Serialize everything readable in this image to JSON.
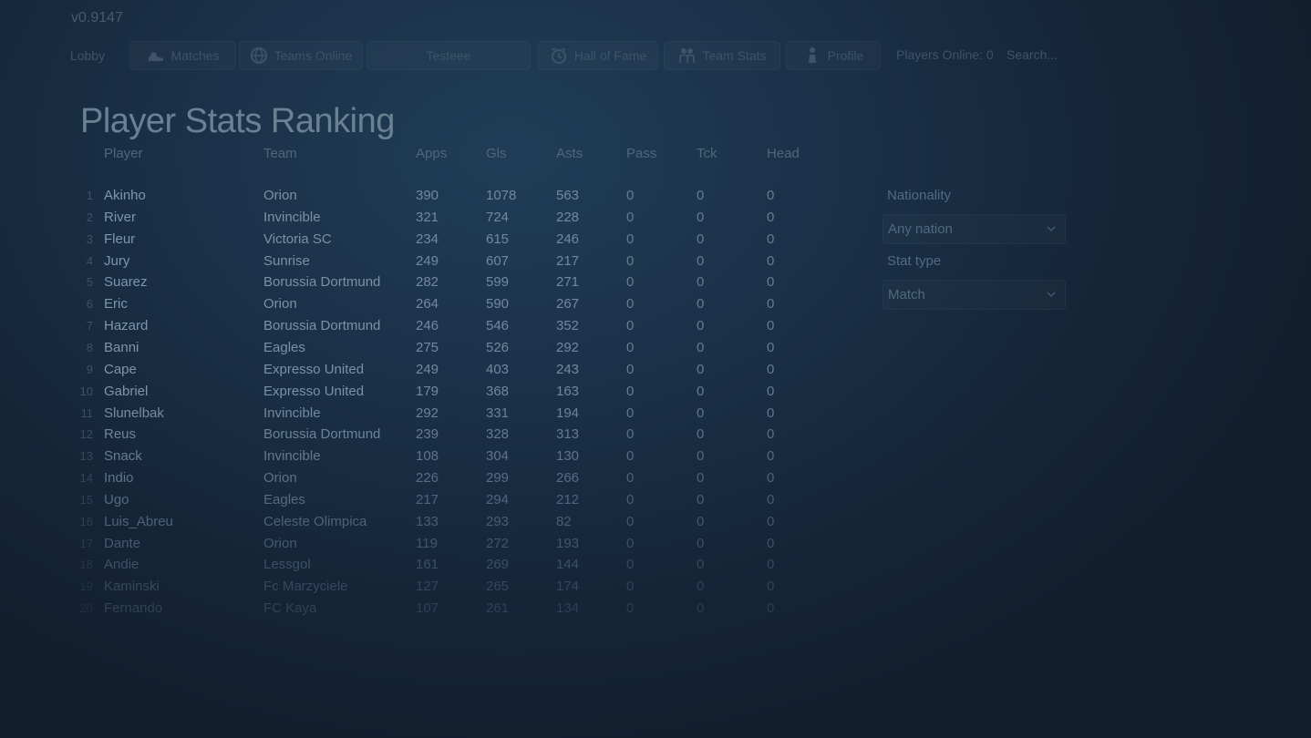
{
  "app": {
    "version": "v0.9147"
  },
  "nav": {
    "items": [
      {
        "label": "Lobby",
        "icon": "",
        "name": "nav-lobby-button",
        "plain": true
      },
      {
        "label": "Matches",
        "icon": "boot-icon",
        "name": "nav-matches-button"
      },
      {
        "label": "Teams Online",
        "icon": "globe-icon",
        "name": "nav-teams-online-button"
      },
      {
        "label": "Testeee",
        "icon": "",
        "name": "nav-testeee-button"
      },
      {
        "label": "Hall of Fame",
        "icon": "clock-icon",
        "name": "nav-hall-of-fame-button"
      },
      {
        "label": "Team Stats",
        "icon": "team-icon",
        "name": "nav-team-stats-button"
      },
      {
        "label": "Profile",
        "icon": "player-icon",
        "name": "nav-profile-button"
      }
    ],
    "players_online": "Players Online: 0",
    "search_placeholder": "Search..."
  },
  "page": {
    "title": "Player Stats Ranking"
  },
  "table": {
    "columns": [
      "Player",
      "Team",
      "Apps",
      "Gls",
      "Asts",
      "Pass",
      "Tck",
      "Head"
    ],
    "rows": [
      {
        "rank": "1",
        "player": "Akinho",
        "team": "Orion",
        "apps": "390",
        "gls": "1078",
        "asts": "563",
        "pass": "0",
        "tck": "0",
        "head": "0"
      },
      {
        "rank": "2",
        "player": "River",
        "team": "Invincible",
        "apps": "321",
        "gls": "724",
        "asts": "228",
        "pass": "0",
        "tck": "0",
        "head": "0"
      },
      {
        "rank": "3",
        "player": "Fleur",
        "team": "Victoria SC",
        "apps": "234",
        "gls": "615",
        "asts": "246",
        "pass": "0",
        "tck": "0",
        "head": "0"
      },
      {
        "rank": "4",
        "player": "Jury",
        "team": "Sunrise",
        "apps": "249",
        "gls": "607",
        "asts": "217",
        "pass": "0",
        "tck": "0",
        "head": "0"
      },
      {
        "rank": "5",
        "player": "Suarez",
        "team": "Borussia Dortmund",
        "apps": "282",
        "gls": "599",
        "asts": "271",
        "pass": "0",
        "tck": "0",
        "head": "0"
      },
      {
        "rank": "6",
        "player": "Eric",
        "team": "Orion",
        "apps": "264",
        "gls": "590",
        "asts": "267",
        "pass": "0",
        "tck": "0",
        "head": "0"
      },
      {
        "rank": "7",
        "player": "Hazard",
        "team": "Borussia Dortmund",
        "apps": "246",
        "gls": "546",
        "asts": "352",
        "pass": "0",
        "tck": "0",
        "head": "0"
      },
      {
        "rank": "8",
        "player": "Banni",
        "team": "Eagles",
        "apps": "275",
        "gls": "526",
        "asts": "292",
        "pass": "0",
        "tck": "0",
        "head": "0"
      },
      {
        "rank": "9",
        "player": "Cape",
        "team": "Expresso United",
        "apps": "249",
        "gls": "403",
        "asts": "243",
        "pass": "0",
        "tck": "0",
        "head": "0"
      },
      {
        "rank": "10",
        "player": "Gabriel",
        "team": "Expresso United",
        "apps": "179",
        "gls": "368",
        "asts": "163",
        "pass": "0",
        "tck": "0",
        "head": "0"
      },
      {
        "rank": "11",
        "player": "Slunelbak",
        "team": "Invincible",
        "apps": "292",
        "gls": "331",
        "asts": "194",
        "pass": "0",
        "tck": "0",
        "head": "0"
      },
      {
        "rank": "12",
        "player": "Reus",
        "team": "Borussia Dortmund",
        "apps": "239",
        "gls": "328",
        "asts": "313",
        "pass": "0",
        "tck": "0",
        "head": "0"
      },
      {
        "rank": "13",
        "player": "Snack",
        "team": "Invincible",
        "apps": "108",
        "gls": "304",
        "asts": "130",
        "pass": "0",
        "tck": "0",
        "head": "0"
      },
      {
        "rank": "14",
        "player": "Indio",
        "team": "Orion",
        "apps": "226",
        "gls": "299",
        "asts": "266",
        "pass": "0",
        "tck": "0",
        "head": "0"
      },
      {
        "rank": "15",
        "player": "Ugo",
        "team": "Eagles",
        "apps": "217",
        "gls": "294",
        "asts": "212",
        "pass": "0",
        "tck": "0",
        "head": "0"
      },
      {
        "rank": "16",
        "player": "Luis_Abreu",
        "team": "Celeste Olimpica",
        "apps": "133",
        "gls": "293",
        "asts": "82",
        "pass": "0",
        "tck": "0",
        "head": "0"
      },
      {
        "rank": "17",
        "player": "Dante",
        "team": "Orion",
        "apps": "119",
        "gls": "272",
        "asts": "193",
        "pass": "0",
        "tck": "0",
        "head": "0"
      },
      {
        "rank": "18",
        "player": "Andie",
        "team": "Lessgol",
        "apps": "161",
        "gls": "269",
        "asts": "144",
        "pass": "0",
        "tck": "0",
        "head": "0"
      },
      {
        "rank": "19",
        "player": "Kaminski",
        "team": "Fc Marzyciele",
        "apps": "127",
        "gls": "265",
        "asts": "174",
        "pass": "0",
        "tck": "0",
        "head": "0"
      },
      {
        "rank": "20",
        "player": "Fernando",
        "team": "FC Kaya",
        "apps": "107",
        "gls": "261",
        "asts": "134",
        "pass": "0",
        "tck": "0",
        "head": "0"
      }
    ]
  },
  "filters": {
    "nationality_label": "Nationality",
    "nationality_value": "Any nation",
    "stat_type_label": "Stat type",
    "stat_type_value": "Match"
  }
}
